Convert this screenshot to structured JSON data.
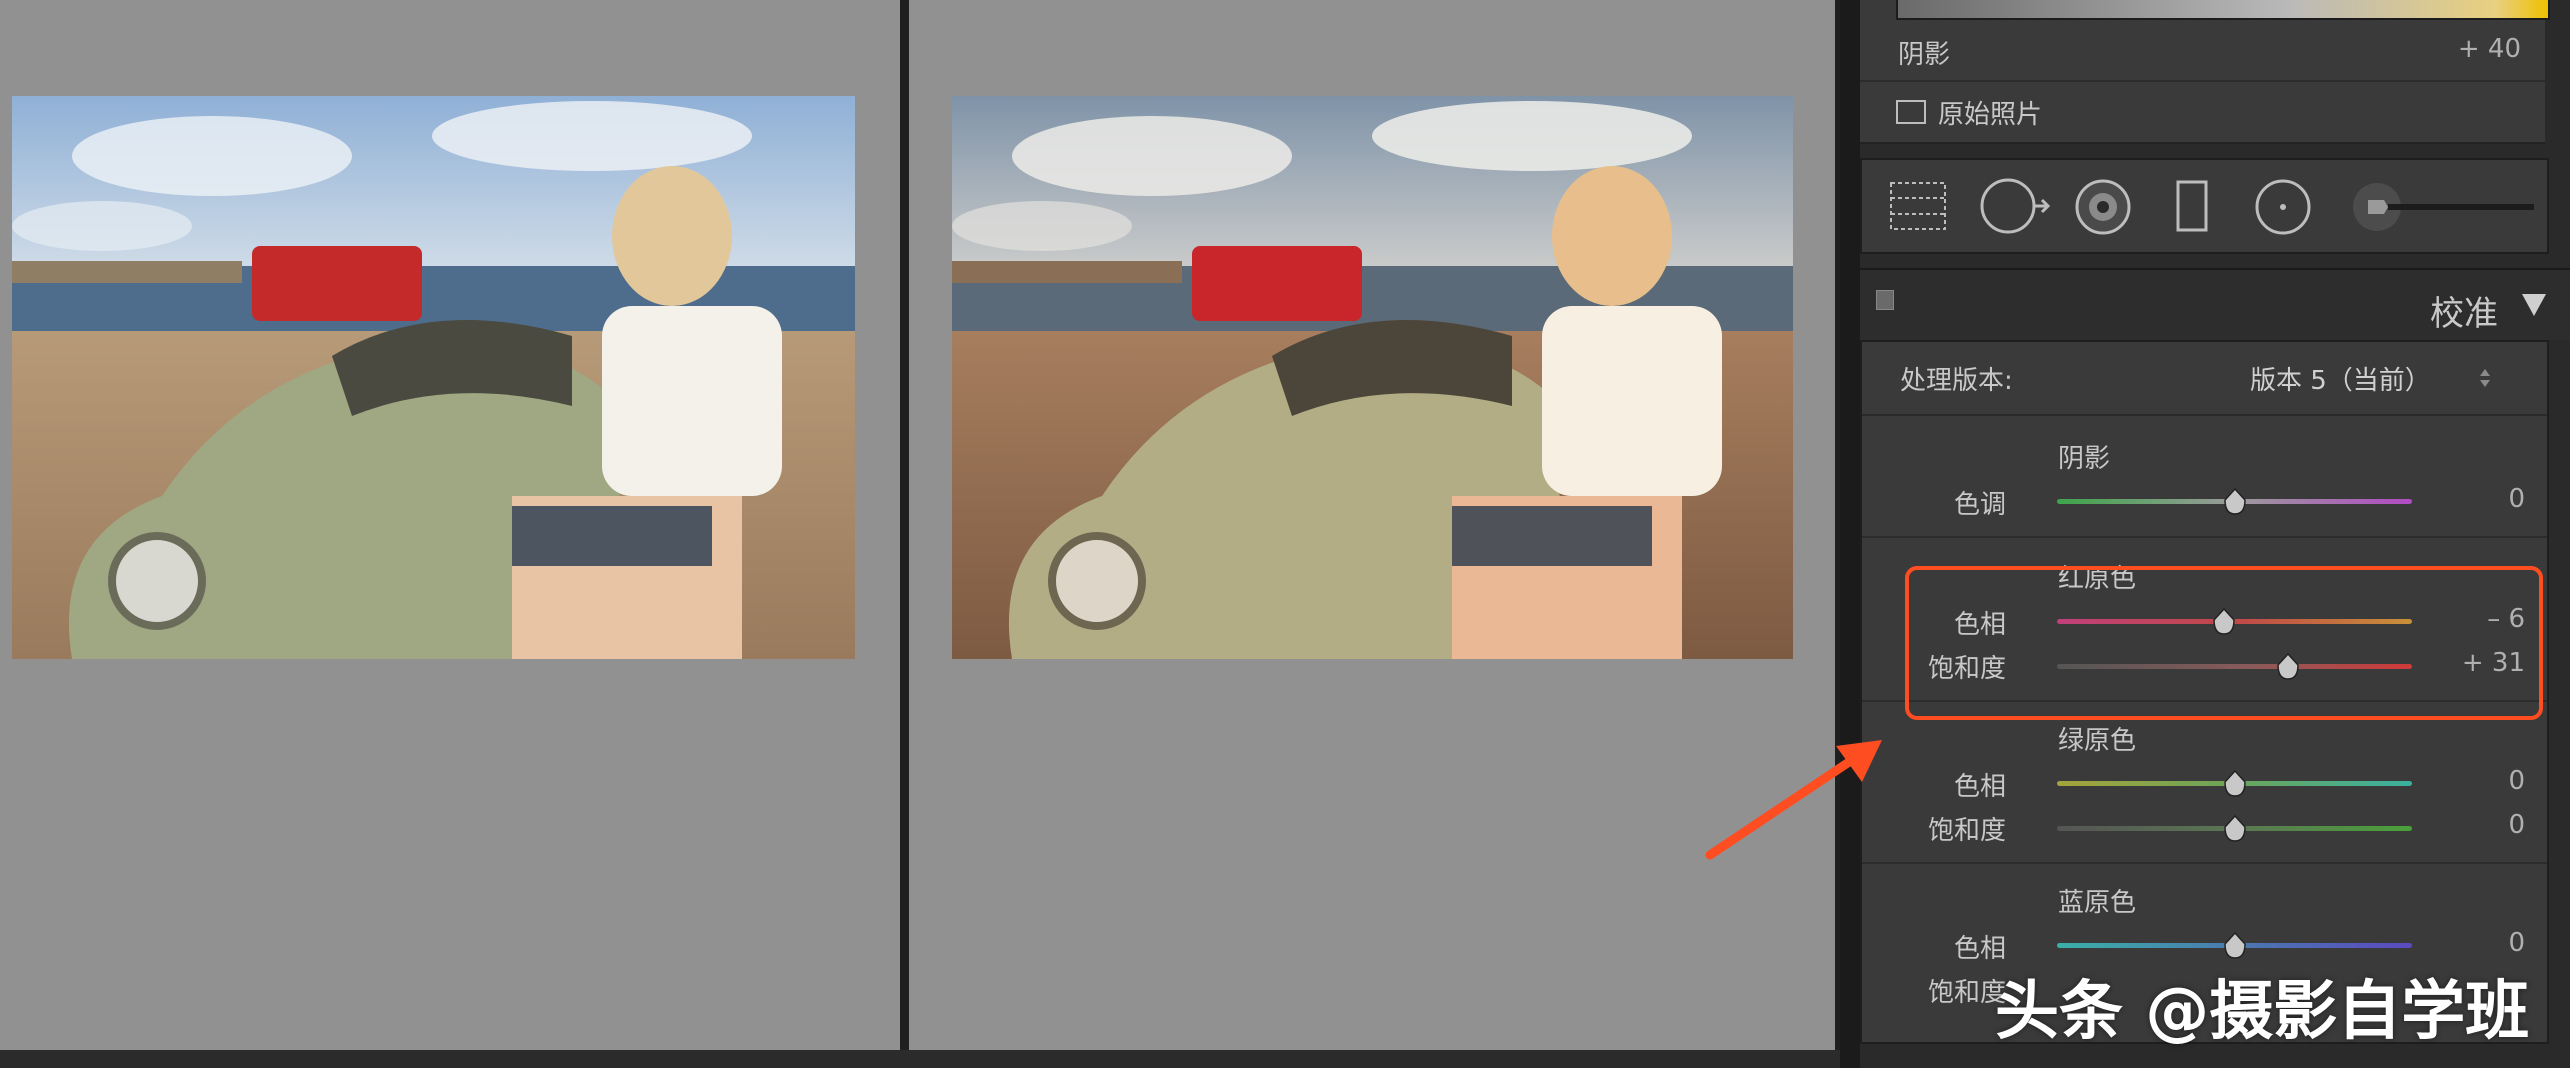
{
  "tone": {
    "shadows_label": "阴影",
    "shadows_value": "+ 40",
    "original_photo_label": "原始照片"
  },
  "calibration": {
    "panel_title": "校准",
    "process_label": "处理版本:",
    "process_value": "版本 5（当前）",
    "shadows_section": "阴影",
    "tint_label": "色调",
    "tint_value": "0",
    "red_section": "红原色",
    "red_hue_label": "色相",
    "red_hue_value": "– 6",
    "red_sat_label": "饱和度",
    "red_sat_value": "+ 31",
    "green_section": "绿原色",
    "green_hue_label": "色相",
    "green_hue_value": "0",
    "green_sat_label": "饱和度",
    "green_sat_value": "0",
    "blue_section": "蓝原色",
    "blue_hue_label": "色相",
    "blue_hue_value": "0",
    "blue_sat_label": "饱和度"
  },
  "sliders": {
    "tint": 0.5,
    "red_hue": 0.47,
    "red_sat": 0.65,
    "green_hue": 0.5,
    "green_sat": 0.5,
    "blue_hue": 0.5
  },
  "watermark": "头条 @摄影自学班",
  "colors": {
    "highlight": "#ff4d22",
    "panel_bg": "#3a3a3a",
    "canvas_bg": "#919191"
  }
}
